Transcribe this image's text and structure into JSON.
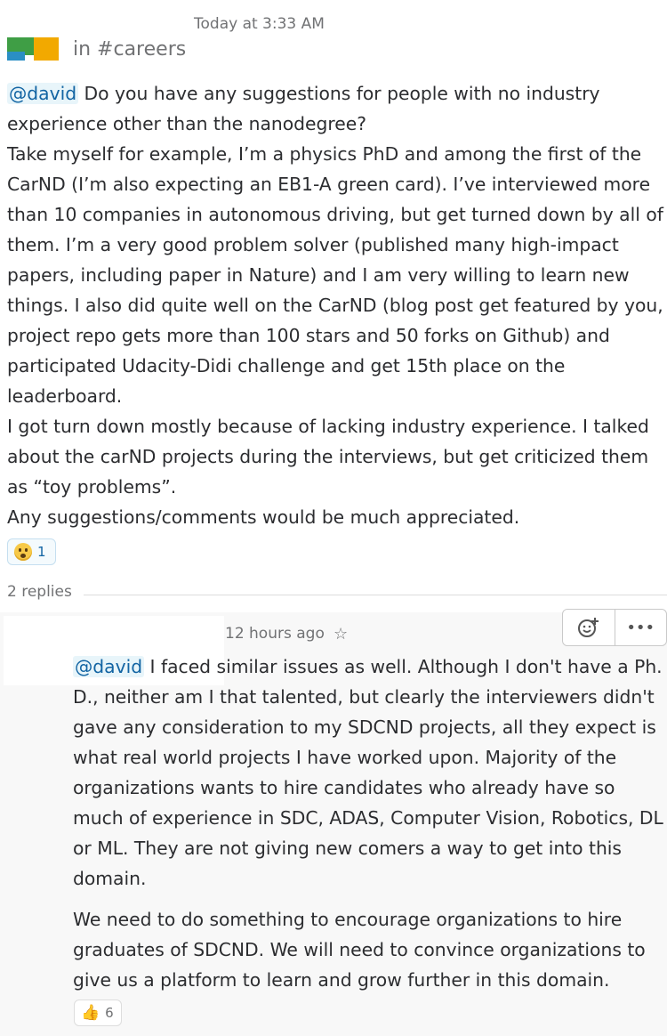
{
  "message": {
    "timestamp": "Today at 3:33 AM",
    "channel": "in #careers",
    "mention": "@david",
    "first_line_rest": " Do you have any suggestions for people with no industry experience other than the nanodegree?",
    "paragraphs": [
      "Take myself for example, I’m a physics PhD and among the first  of the CarND (I’m also expecting an EB1-A green card). I’ve interviewed more than 10 companies in autonomous driving, but get turned down by all of them. I’m a very good problem solver (published many high-impact papers, including paper in Nature) and I am very willing to learn new things. I also did quite well on the CarND (blog post get featured by you, project repo gets more than 100 stars and 50 forks on Github) and participated Udacity-Didi challenge and get 15th place on the leaderboard.",
      "I got turn down mostly because of lacking industry experience. I talked about the carND projects during the interviews, but get criticized them as “toy problems”.",
      "Any suggestions/comments would be much appreciated."
    ],
    "reaction": {
      "emoji": "hushed-face-icon",
      "count": "1"
    },
    "replies_label": "2 replies"
  },
  "reply": {
    "timestamp": "12 hours ago",
    "mention": "@david",
    "first_para_rest": " I faced similar issues as well. Although I don't have a Ph. D., neither am I that talented, but clearly the interviewers didn't gave any consideration to my SDCND projects, all they expect is what real world projects I have worked upon. Majority of the organizations wants to hire candidates who already have so much of experience in SDC, ADAS, Computer Vision, Robotics, DL or ML. They are not giving new comers a way to get into this domain.",
    "second_para": "We need to do something to encourage organizations to hire graduates of SDCND. We will need to convince organizations to give us a platform to learn and grow further in this domain.",
    "reaction": {
      "emoji": "thumbs-up-icon",
      "count": "6"
    }
  },
  "actions": {
    "add_reaction_icon": "add-reaction-icon",
    "more_icon": "more-actions-icon"
  }
}
